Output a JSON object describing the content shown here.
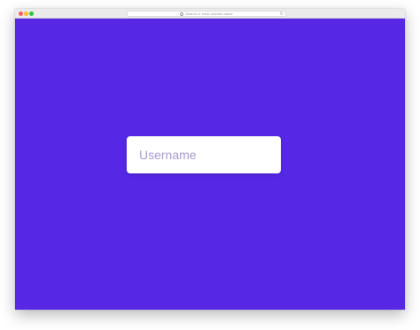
{
  "browser": {
    "address_placeholder": "Search or enter website name",
    "traffic_colors": {
      "close": "#fc5f57",
      "minimize": "#fdbc2e",
      "maximize": "#28c840"
    }
  },
  "page": {
    "background_color": "#5628e6",
    "username_field": {
      "placeholder": "Username",
      "value": ""
    }
  }
}
